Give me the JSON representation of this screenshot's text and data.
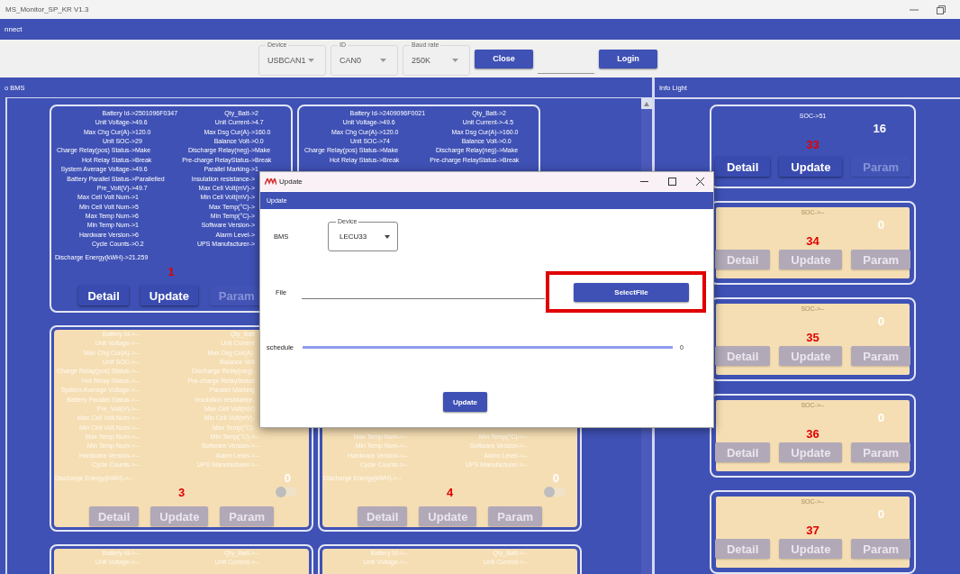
{
  "window": {
    "title": "MS_Monitor_SP_KR V1.3"
  },
  "menu": {
    "label": "nnect"
  },
  "toolbar": {
    "dropdowns": [
      {
        "legend": "Device",
        "value": "USBCAN1"
      },
      {
        "legend": "ID",
        "value": "CAN0"
      },
      {
        "legend": "Baud rate",
        "value": "250K"
      }
    ],
    "close_button": "Close",
    "login_button": "Login"
  },
  "panels": {
    "left_title": "o BMS",
    "right_title": "Info Light"
  },
  "bms_cards": [
    {
      "online": true,
      "rows": [
        {
          "l": {
            "label": "Battery Id->",
            "value": "2501096F0347"
          },
          "r": {
            "label": "Qty_Batt->",
            "value": "2"
          }
        },
        {
          "l": {
            "label": "Unit Voltage->",
            "value": "49.6"
          },
          "r": {
            "label": "Unit Current->",
            "value": "4.7"
          }
        },
        {
          "l": {
            "label": "Max Chg Cur(A)->",
            "value": "120.0"
          },
          "r": {
            "label": "Max Dsg Cur(A)->",
            "value": "160.0"
          }
        },
        {
          "l": {
            "label": "Unit SOC->",
            "value": "29"
          },
          "r": {
            "label": "Balance Volt->",
            "value": "0.0"
          }
        },
        {
          "l": {
            "label": "Charge Relay(pos) Status->",
            "value": "Make"
          },
          "r": {
            "label": "Discharge Relay(neg)->",
            "value": "Make"
          }
        },
        {
          "l": {
            "label": "Hot Relay Status->",
            "value": "Break"
          },
          "r": {
            "label": "Pre-charge RelayStatus->",
            "value": "Break"
          }
        },
        {
          "l": {
            "label": "System Average Voltage->",
            "value": "49.6"
          },
          "r": {
            "label": "Parallel Marking->",
            "value": "1"
          }
        },
        {
          "l": {
            "label": "Battery Parallel Status->",
            "value": "Parallelled"
          },
          "r": {
            "label": "Insulation resistance->"
          }
        },
        {
          "l": {
            "label": "Pre_Volt(V)->",
            "value": "49.7"
          },
          "r": {
            "label": "Max Cell Volt(mV)->"
          }
        },
        {
          "l": {
            "label": "Max Cell Volt Num->",
            "value": "1"
          },
          "r": {
            "label": "Min Cell Volt(mV)->"
          }
        },
        {
          "l": {
            "label": "Min Cell Volt Num->",
            "value": "5"
          },
          "r": {
            "label": "Max Temp(°C)->"
          }
        },
        {
          "l": {
            "label": "Max Temp Num->",
            "value": "6"
          },
          "r": {
            "label": "Min Temp(°C)->"
          }
        },
        {
          "l": {
            "label": "Min Temp Num->",
            "value": "1"
          },
          "r": {
            "label": "Software Version->"
          }
        },
        {
          "l": {
            "label": "Hardware Version->",
            "value": "6"
          },
          "r": {
            "label": "Alarm Level->"
          }
        },
        {
          "l": {
            "label": "Cycle Counts->",
            "value": "0.2"
          },
          "r": {
            "label": "UPS Manufacturer->"
          }
        }
      ],
      "energy": {
        "label": "Discharge Energy(kWH)->",
        "value": "21.259"
      },
      "number": "1",
      "buttons": [
        {
          "label": "Detail",
          "disabled": false
        },
        {
          "label": "Update",
          "disabled": false
        },
        {
          "label": "Param",
          "disabled": true
        }
      ]
    },
    {
      "online": true,
      "rows": [
        {
          "l": {
            "label": "Battery Id->",
            "value": "2409096F0021"
          },
          "r": {
            "label": "Qty_Batt->",
            "value": "2"
          }
        },
        {
          "l": {
            "label": "Unit Voltage->",
            "value": "49.6"
          },
          "r": {
            "label": "Unit Current->",
            "value": "-4.5"
          }
        },
        {
          "l": {
            "label": "Max Chg Cur(A)->",
            "value": "120.0"
          },
          "r": {
            "label": "Max Dsg Cur(A)->",
            "value": "160.0"
          }
        },
        {
          "l": {
            "label": "Unit SOC->",
            "value": "74"
          },
          "r": {
            "label": "Balance Volt->",
            "value": "0.0"
          }
        },
        {
          "l": {
            "label": "Charge Relay(pos) Status->",
            "value": "Make"
          },
          "r": {
            "label": "Discharge Relay(neg)->",
            "value": "Make"
          }
        },
        {
          "l": {
            "label": "Hot Relay Status->",
            "value": "Break"
          },
          "r": {
            "label": "Pre-charge RelayStatus->",
            "value": "Break"
          }
        }
      ]
    },
    {
      "online": false,
      "rows": [
        {
          "l": {
            "label": "Battery Id->",
            "value": "--"
          },
          "r": {
            "label": "Qty_Batt"
          }
        },
        {
          "l": {
            "label": "Unit Voltage->",
            "value": "--"
          },
          "r": {
            "label": "Unit Current"
          }
        },
        {
          "l": {
            "label": "Max Chg Cur(A)->",
            "value": "--"
          },
          "r": {
            "label": "Max Dsg Cur(A)-"
          }
        },
        {
          "l": {
            "label": "Unit SOC->",
            "value": "--"
          },
          "r": {
            "label": "Balance Volt"
          }
        },
        {
          "l": {
            "label": "Charge Relay(pos) Status->",
            "value": "--"
          },
          "r": {
            "label": "Discharge Relay(neg)-"
          }
        },
        {
          "l": {
            "label": "Hot Relay Status->",
            "value": "--"
          },
          "r": {
            "label": "Pre-charge RelayStatus"
          }
        },
        {
          "l": {
            "label": "System Average Voltage->",
            "value": "--"
          },
          "r": {
            "label": "Parallel Marking"
          }
        },
        {
          "l": {
            "label": "Battery Parallel Status->",
            "value": "--"
          },
          "r": {
            "label": "Insulation resistance-"
          }
        },
        {
          "l": {
            "label": "Pre_Volt(V)->",
            "value": "--"
          },
          "r": {
            "label": "Max Cell Volt(mV)"
          }
        },
        {
          "l": {
            "label": "Max Cell Volt Num->",
            "value": "--"
          },
          "r": {
            "label": "Min Cell Volt(mV)-"
          }
        },
        {
          "l": {
            "label": "Min Cell Volt Num->",
            "value": "--"
          },
          "r": {
            "label": "Max Temp(°C)-"
          }
        },
        {
          "l": {
            "label": "Max Temp Num->",
            "value": "--"
          },
          "r": {
            "label": "Min Temp(°C)->",
            "value": "--"
          }
        },
        {
          "l": {
            "label": "Min Temp Num->",
            "value": "--"
          },
          "r": {
            "label": "Software Version->",
            "value": "--"
          }
        },
        {
          "l": {
            "label": "Hardware Version->",
            "value": "--"
          },
          "r": {
            "label": "Alarm Level->",
            "value": "--"
          }
        },
        {
          "l": {
            "label": "Cycle Counts->",
            "value": "--"
          },
          "r": {
            "label": "UPS Manufacturer->",
            "value": "--"
          }
        }
      ],
      "energy": {
        "label": "Discharge Energy(kWH)->",
        "value": "--"
      },
      "count": "0",
      "toggle": {
        "on": false
      },
      "number": "3",
      "buttons": [
        {
          "label": "Detail",
          "disabled": true
        },
        {
          "label": "Update",
          "disabled": true
        },
        {
          "label": "Param",
          "disabled": true
        }
      ]
    },
    {
      "online": false,
      "rows": [
        {},
        {},
        {},
        {},
        {},
        {},
        {},
        {},
        {},
        {},
        {},
        {
          "l": {
            "label": "Max Temp Num->",
            "value": "--"
          },
          "r": {
            "label": "Min Temp(°C)->",
            "value": "--"
          }
        },
        {
          "l": {
            "label": "Min Temp Num->",
            "value": "--"
          },
          "r": {
            "label": "Software Version->",
            "value": "--"
          }
        },
        {
          "l": {
            "label": "Hardware Version->",
            "value": "--"
          },
          "r": {
            "label": "Alarm Level->",
            "value": "--"
          }
        },
        {
          "l": {
            "label": "Cycle Counts->",
            "value": "--"
          },
          "r": {
            "label": "UPS Manufacturer->",
            "value": "--"
          }
        }
      ],
      "energy": {
        "label": "Discharge Energy(kWH)->",
        "value": "--"
      },
      "count": "0",
      "toggle": {
        "on": false
      },
      "number": "4",
      "buttons": [
        {
          "label": "Detail",
          "disabled": true
        },
        {
          "label": "Update",
          "disabled": true
        },
        {
          "label": "Param",
          "disabled": true
        }
      ]
    },
    {
      "online": false,
      "rows": [
        {
          "l": {
            "label": "Battery Id->",
            "value": "--"
          },
          "r": {
            "label": "Qty_Batt->",
            "value": "--"
          }
        },
        {
          "l": {
            "label": "Unit Voltage->",
            "value": "--"
          },
          "r": {
            "label": "Unit Current->",
            "value": "--"
          }
        }
      ]
    },
    {
      "online": false,
      "rows": [
        {
          "l": {
            "label": "Battery Id->",
            "value": "--"
          },
          "r": {
            "label": "Qty_Batt->",
            "value": "--"
          }
        },
        {
          "l": {
            "label": "Unit Voltage->",
            "value": "--"
          },
          "r": {
            "label": "Unit Current->",
            "value": "--"
          }
        }
      ]
    }
  ],
  "info_cards": [
    {
      "online": true,
      "soc": "SOC->51",
      "count": "16",
      "number": "33",
      "buttons": [
        {
          "label": "Detail",
          "disabled": false
        },
        {
          "label": "Update",
          "disabled": false
        },
        {
          "label": "Param",
          "disabled": true
        }
      ]
    },
    {
      "online": false,
      "soc": "SOC->--",
      "count": "0",
      "number": "34",
      "buttons": [
        {
          "label": "Detail",
          "disabled": true
        },
        {
          "label": "Update",
          "disabled": true
        },
        {
          "label": "Param",
          "disabled": true
        }
      ]
    },
    {
      "online": false,
      "soc": "SOC->--",
      "count": "0",
      "number": "35",
      "buttons": [
        {
          "label": "Detail",
          "disabled": true
        },
        {
          "label": "Update",
          "disabled": true
        },
        {
          "label": "Param",
          "disabled": true
        }
      ]
    },
    {
      "online": false,
      "soc": "SOC->--",
      "count": "0",
      "number": "36",
      "buttons": [
        {
          "label": "Detail",
          "disabled": true
        },
        {
          "label": "Update",
          "disabled": true
        },
        {
          "label": "Param",
          "disabled": true
        }
      ]
    },
    {
      "online": false,
      "soc": "SOC->--",
      "count": "0",
      "number": "37",
      "buttons": [
        {
          "label": "Detail",
          "disabled": true
        },
        {
          "label": "Update",
          "disabled": true
        },
        {
          "label": "Param",
          "disabled": true
        }
      ]
    }
  ],
  "dialog": {
    "title": "Update",
    "header": "Update",
    "bms_label": "BMS",
    "device": {
      "legend": "Device",
      "value": "LECU33"
    },
    "file_label": "File",
    "select_button": "SelectFile",
    "highlighted": true,
    "schedule_label": "schedule",
    "schedule": {
      "level": 0,
      "reading": "0"
    },
    "update_button": "Update"
  }
}
